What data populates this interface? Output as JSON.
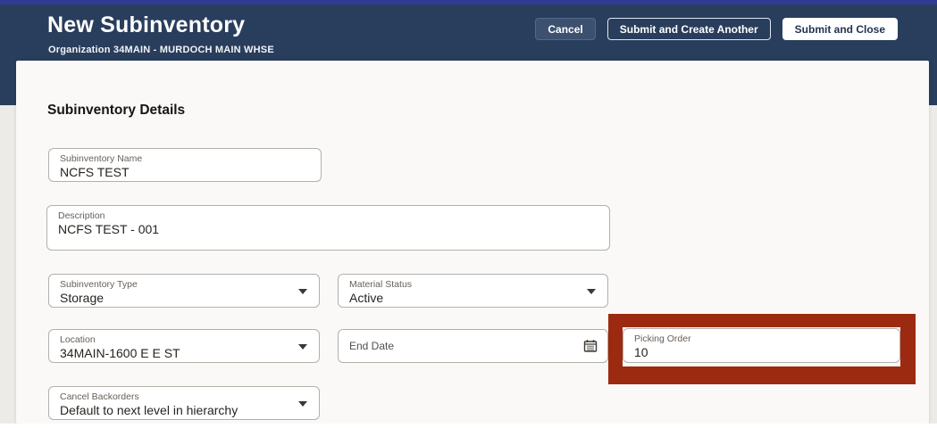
{
  "colors": {
    "top_strip": "#2e3c93",
    "header_navy": "#293e5c",
    "page_bg": "#ecebe8",
    "panel_bg": "#faf9f7",
    "field_border": "#b3b0ac",
    "label_gray": "#665f59",
    "text_dark": "#272420",
    "button_cancel_bg": "#3c516f",
    "highlight_red": "#9c2a10"
  },
  "header": {
    "title": "New Subinventory",
    "subtitle": "Organization 34MAIN - MURDOCH MAIN WHSE",
    "buttons": {
      "cancel": "Cancel",
      "submit_create_another": "Submit and Create Another",
      "submit_close": "Submit and Close"
    }
  },
  "section": {
    "title": "Subinventory Details"
  },
  "fields": {
    "subinventory_name": {
      "label": "Subinventory Name",
      "value": "NCFS TEST"
    },
    "description": {
      "label": "Description",
      "value": "NCFS TEST - 001"
    },
    "subinventory_type": {
      "label": "Subinventory Type",
      "value": "Storage"
    },
    "material_status": {
      "label": "Material Status",
      "value": "Active"
    },
    "location": {
      "label": "Location",
      "value": "34MAIN-1600 E E ST"
    },
    "end_date": {
      "label": "End Date",
      "value": ""
    },
    "picking_order": {
      "label": "Picking Order",
      "value": "10"
    },
    "cancel_backorders": {
      "label": "Cancel Backorders",
      "value": "Default to next level in hierarchy"
    }
  },
  "icons": {
    "caret_down": "caret-down-icon",
    "calendar": "calendar-icon"
  }
}
